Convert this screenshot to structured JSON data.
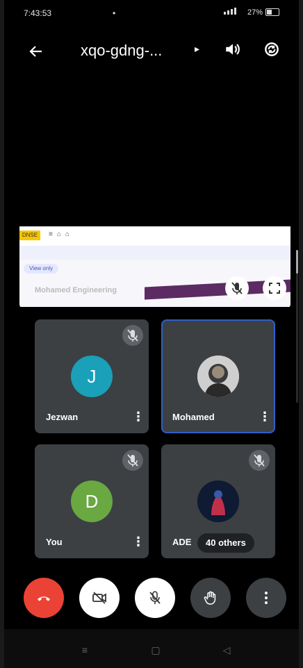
{
  "status_bar": {
    "time": "7:43:53",
    "right_text": "27%"
  },
  "header": {
    "meeting_code": "xqo-gdng-..."
  },
  "presentation": {
    "badge": "DNSE",
    "view_only": "View only",
    "presenter_name": "Mohamed Engineering"
  },
  "participants": [
    {
      "name": "Jezwan",
      "initial": "J",
      "avatar_color": "#1aa0b8"
    },
    {
      "name": "Mohamed",
      "initial": "",
      "avatar_color": "#d9d9d9"
    },
    {
      "name": "You",
      "initial": "D",
      "avatar_color": "#6aa842"
    },
    {
      "name": "ADE",
      "initial": "",
      "avatar_color": "#1b2a4a"
    }
  ],
  "others_label": "40 others",
  "colors": {
    "end_call": "#ea4335",
    "tile_bg": "#3c4043",
    "active_border": "#2f5ec7"
  }
}
